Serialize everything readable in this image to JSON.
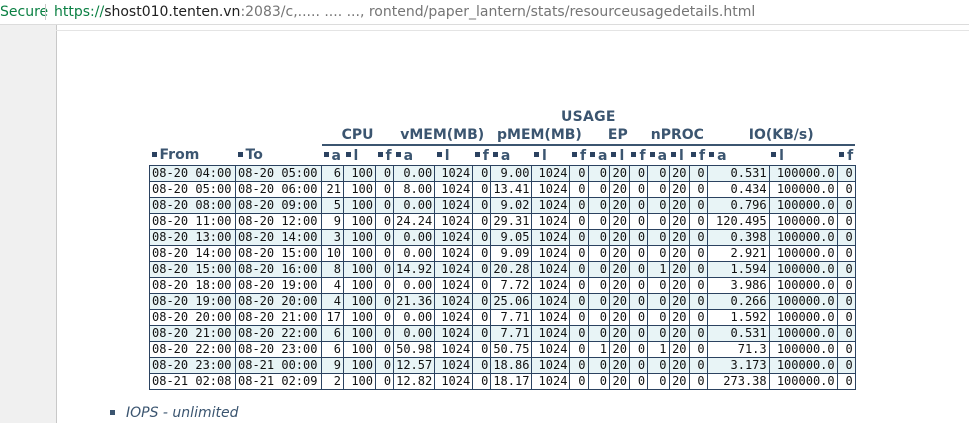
{
  "browser": {
    "secure_label": "Secure",
    "url_scheme": "https://",
    "url_host": "shost010.tenten.vn",
    "url_rest": ":2083/c,.....  .... ..., rontend/paper_lantern/stats/resourceusagedetails.html"
  },
  "table": {
    "title": "USAGE",
    "groups": [
      "CPU",
      "vMEM(MB)",
      "pMEM(MB)",
      "EP",
      "nPROC",
      "IO(KB/s)"
    ],
    "from_label": "From",
    "to_label": "To",
    "sub_labels": [
      "a",
      "l",
      "f",
      "a",
      "l",
      "f",
      "a",
      "l",
      "f",
      "a",
      "l",
      "f",
      "a",
      "l",
      "f",
      "a",
      "l",
      "f"
    ],
    "rows": [
      [
        "08-20 04:00",
        "08-20 05:00",
        "6",
        "100",
        "0",
        "0.00",
        "1024",
        "0",
        "9.00",
        "1024",
        "0",
        "0",
        "20",
        "0",
        "0",
        "20",
        "0",
        "0.531",
        "100000.0",
        "0"
      ],
      [
        "08-20 05:00",
        "08-20 06:00",
        "21",
        "100",
        "0",
        "8.00",
        "1024",
        "0",
        "13.41",
        "1024",
        "0",
        "0",
        "20",
        "0",
        "0",
        "20",
        "0",
        "0.434",
        "100000.0",
        "0"
      ],
      [
        "08-20 08:00",
        "08-20 09:00",
        "5",
        "100",
        "0",
        "0.00",
        "1024",
        "0",
        "9.02",
        "1024",
        "0",
        "0",
        "20",
        "0",
        "0",
        "20",
        "0",
        "0.796",
        "100000.0",
        "0"
      ],
      [
        "08-20 11:00",
        "08-20 12:00",
        "9",
        "100",
        "0",
        "24.24",
        "1024",
        "0",
        "29.31",
        "1024",
        "0",
        "0",
        "20",
        "0",
        "0",
        "20",
        "0",
        "120.495",
        "100000.0",
        "0"
      ],
      [
        "08-20 13:00",
        "08-20 14:00",
        "3",
        "100",
        "0",
        "0.00",
        "1024",
        "0",
        "9.05",
        "1024",
        "0",
        "0",
        "20",
        "0",
        "0",
        "20",
        "0",
        "0.398",
        "100000.0",
        "0"
      ],
      [
        "08-20 14:00",
        "08-20 15:00",
        "10",
        "100",
        "0",
        "0.00",
        "1024",
        "0",
        "9.09",
        "1024",
        "0",
        "0",
        "20",
        "0",
        "0",
        "20",
        "0",
        "2.921",
        "100000.0",
        "0"
      ],
      [
        "08-20 15:00",
        "08-20 16:00",
        "8",
        "100",
        "0",
        "14.92",
        "1024",
        "0",
        "20.28",
        "1024",
        "0",
        "0",
        "20",
        "0",
        "1",
        "20",
        "0",
        "1.594",
        "100000.0",
        "0"
      ],
      [
        "08-20 18:00",
        "08-20 19:00",
        "4",
        "100",
        "0",
        "0.00",
        "1024",
        "0",
        "7.72",
        "1024",
        "0",
        "0",
        "20",
        "0",
        "0",
        "20",
        "0",
        "3.986",
        "100000.0",
        "0"
      ],
      [
        "08-20 19:00",
        "08-20 20:00",
        "4",
        "100",
        "0",
        "21.36",
        "1024",
        "0",
        "25.06",
        "1024",
        "0",
        "0",
        "20",
        "0",
        "0",
        "20",
        "0",
        "0.266",
        "100000.0",
        "0"
      ],
      [
        "08-20 20:00",
        "08-20 21:00",
        "17",
        "100",
        "0",
        "0.00",
        "1024",
        "0",
        "7.71",
        "1024",
        "0",
        "0",
        "20",
        "0",
        "0",
        "20",
        "0",
        "1.592",
        "100000.0",
        "0"
      ],
      [
        "08-20 21:00",
        "08-20 22:00",
        "6",
        "100",
        "0",
        "0.00",
        "1024",
        "0",
        "7.71",
        "1024",
        "0",
        "0",
        "20",
        "0",
        "0",
        "20",
        "0",
        "0.531",
        "100000.0",
        "0"
      ],
      [
        "08-20 22:00",
        "08-20 23:00",
        "6",
        "100",
        "0",
        "50.98",
        "1024",
        "0",
        "50.75",
        "1024",
        "0",
        "1",
        "20",
        "0",
        "1",
        "20",
        "0",
        "71.3",
        "100000.0",
        "0"
      ],
      [
        "08-20 23:00",
        "08-21 00:00",
        "9",
        "100",
        "0",
        "12.57",
        "1024",
        "0",
        "18.86",
        "1024",
        "0",
        "0",
        "20",
        "0",
        "0",
        "20",
        "0",
        "3.173",
        "100000.0",
        "0"
      ],
      [
        "08-21 02:08",
        "08-21 02:09",
        "2",
        "100",
        "0",
        "12.82",
        "1024",
        "0",
        "18.17",
        "1024",
        "0",
        "0",
        "20",
        "0",
        "0",
        "20",
        "0",
        "273.38",
        "100000.0",
        "0"
      ]
    ]
  },
  "footer": {
    "iops_text": "IOPS - unlimited"
  }
}
